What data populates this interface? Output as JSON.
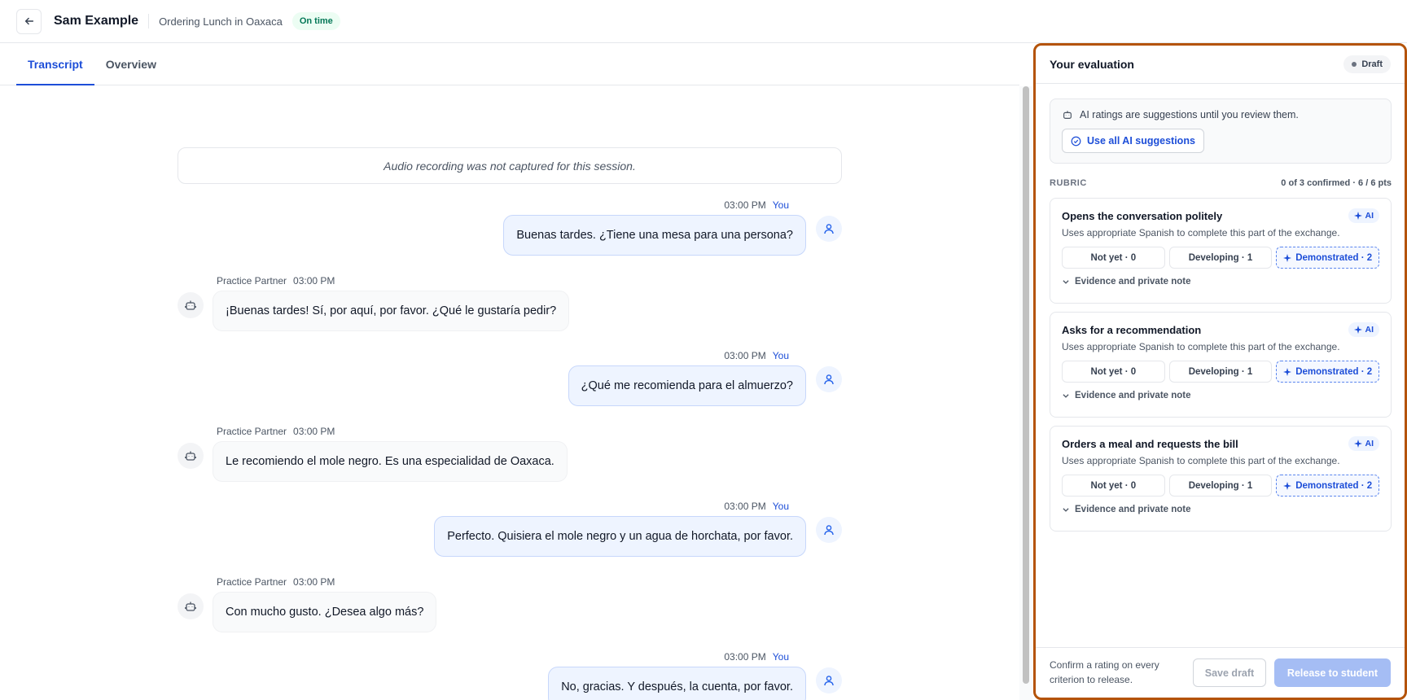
{
  "header": {
    "student_name": "Sam Example",
    "lesson_title": "Ordering Lunch in Oaxaca",
    "status": "On time"
  },
  "tabs": [
    {
      "label": "Transcript",
      "active": true
    },
    {
      "label": "Overview",
      "active": false
    }
  ],
  "transcript": {
    "notice": "Audio recording was not captured for this session.",
    "messages": [
      {
        "speaker": "You",
        "time": "03:00 PM",
        "text": "Buenas tardes. ¿Tiene una mesa para una persona?"
      },
      {
        "speaker": "Practice Partner",
        "time": "03:00 PM",
        "text": "¡Buenas tardes! Sí, por aquí, por favor. ¿Qué le gustaría pedir?"
      },
      {
        "speaker": "You",
        "time": "03:00 PM",
        "text": "¿Qué me recomienda para el almuerzo?"
      },
      {
        "speaker": "Practice Partner",
        "time": "03:00 PM",
        "text": "Le recomiendo el mole negro. Es una especialidad de Oaxaca."
      },
      {
        "speaker": "You",
        "time": "03:00 PM",
        "text": "Perfecto. Quisiera el mole negro y un agua de horchata, por favor."
      },
      {
        "speaker": "Practice Partner",
        "time": "03:00 PM",
        "text": "Con mucho gusto. ¿Desea algo más?"
      },
      {
        "speaker": "You",
        "time": "03:00 PM",
        "text": "No, gracias. Y después, la cuenta, por favor."
      }
    ]
  },
  "evaluation": {
    "title": "Your evaluation",
    "status": "Draft",
    "ai_note": "AI ratings are suggestions until you review them.",
    "use_ai_label": "Use all AI suggestions",
    "rubric_label": "RUBRIC",
    "rubric_summary": "0 of 3 confirmed · 6 / 6 pts",
    "criteria": [
      {
        "title": "Opens the conversation politely",
        "ai_badge": "AI",
        "description": "Uses appropriate Spanish to complete this part of the exchange.",
        "levels": [
          "Not yet · 0",
          "Developing · 1",
          "Demonstrated · 2"
        ],
        "suggested_level": 2,
        "evidence_label": "Evidence and private note"
      },
      {
        "title": "Asks for a recommendation",
        "ai_badge": "AI",
        "description": "Uses appropriate Spanish to complete this part of the exchange.",
        "levels": [
          "Not yet · 0",
          "Developing · 1",
          "Demonstrated · 2"
        ],
        "suggested_level": 2,
        "evidence_label": "Evidence and private note"
      },
      {
        "title": "Orders a meal and requests the bill",
        "ai_badge": "AI",
        "description": "Uses appropriate Spanish to complete this part of the exchange.",
        "levels": [
          "Not yet · 0",
          "Developing · 1",
          "Demonstrated · 2"
        ],
        "suggested_level": 2,
        "evidence_label": "Evidence and private note"
      }
    ],
    "footer_note": "Confirm a rating on every criterion to release.",
    "save_label": "Save draft",
    "release_label": "Release to student"
  },
  "colors": {
    "accent": "#1d4ed8",
    "status_green": "#047857",
    "panel_border": "#b45309"
  },
  "icons": {
    "back": "arrow-left-icon",
    "user": "user-icon",
    "bot": "bot-icon",
    "sparkle": "sparkle-icon",
    "check_circle": "check-circle-icon",
    "chevron": "chevron-down-icon"
  }
}
